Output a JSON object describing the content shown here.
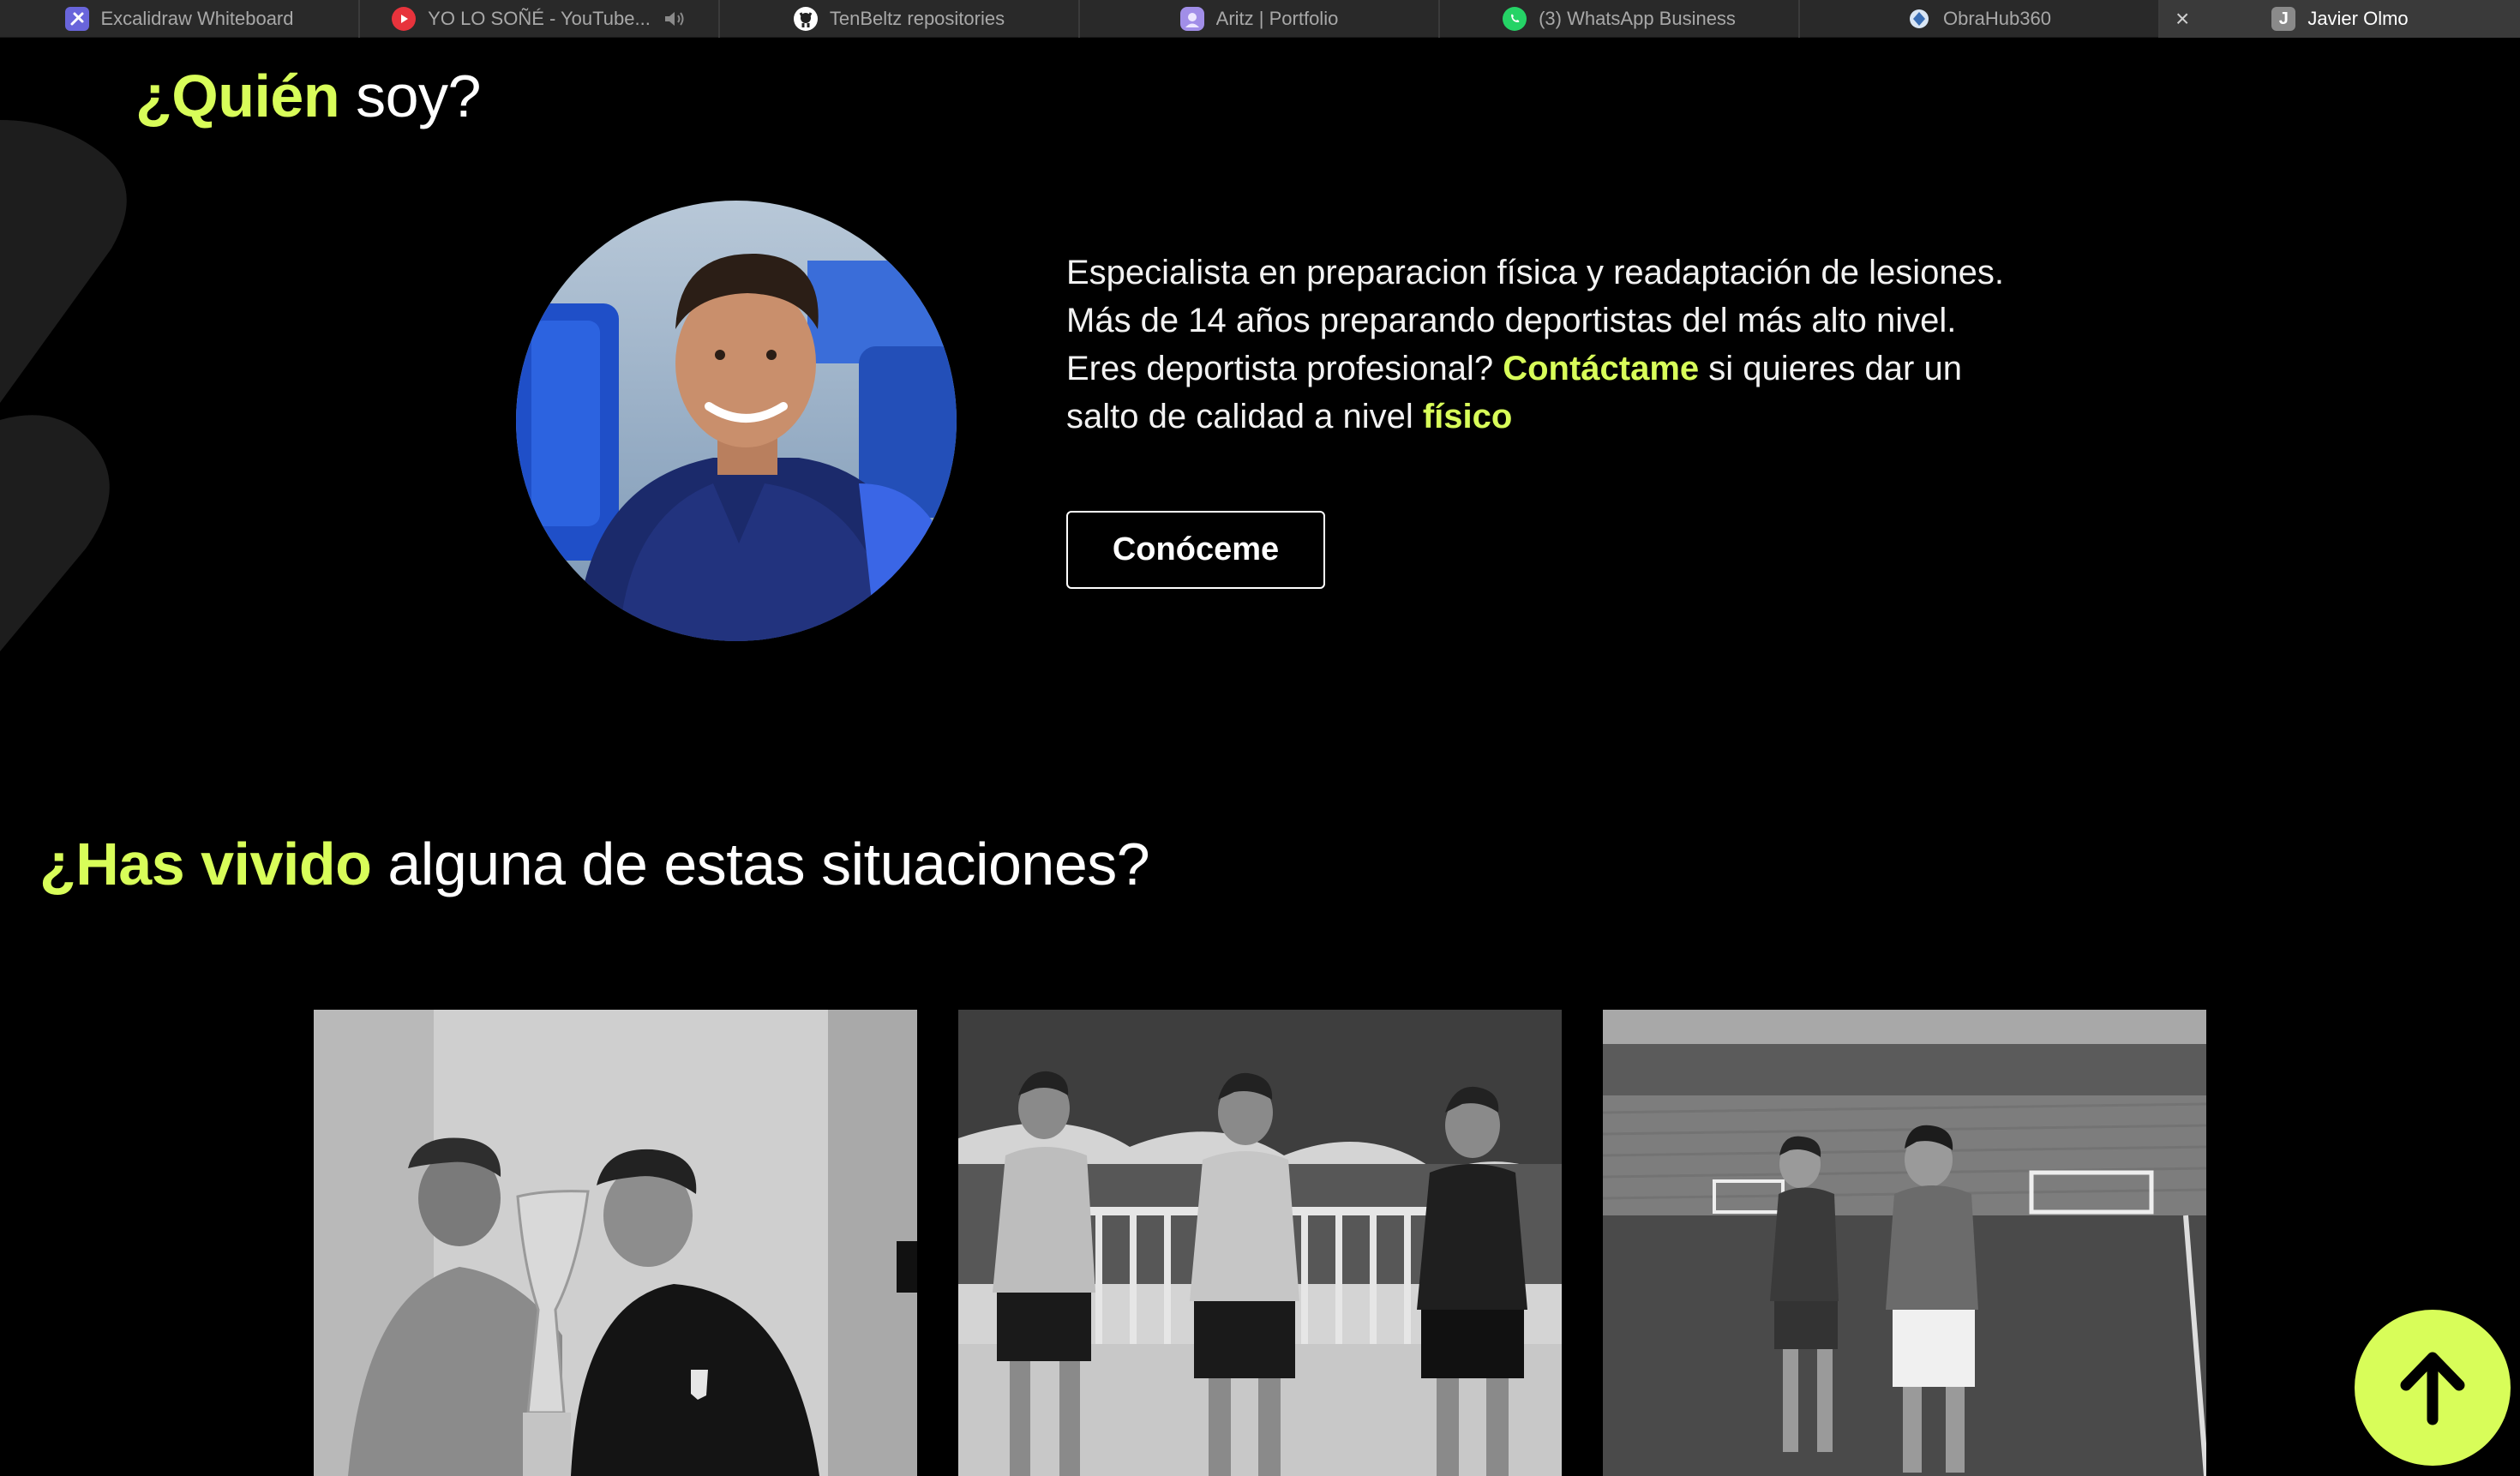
{
  "browser": {
    "tabs": [
      {
        "title": "Excalidraw Whiteboard",
        "icon": "excalidraw-icon",
        "active": false
      },
      {
        "title": "YO LO SOÑÉ - YouTube...",
        "icon": "youtube-icon",
        "active": false,
        "audio": true
      },
      {
        "title": "TenBeltz repositories",
        "icon": "github-icon",
        "active": false
      },
      {
        "title": "Aritz | Portfolio",
        "icon": "portfolio-icon",
        "active": false
      },
      {
        "title": "(3) WhatsApp Business",
        "icon": "whatsapp-icon",
        "active": false
      },
      {
        "title": "ObraHub360",
        "icon": "obrahub-icon",
        "active": false
      },
      {
        "title": "Javier Olmo",
        "icon": "letter-avatar-icon",
        "icon_letter": "J",
        "active": true
      }
    ]
  },
  "about": {
    "title_highlight": "¿Quién",
    "title_rest": "soy?",
    "line1": "Especialista en preparacion física y readaptación de lesiones.",
    "line2": "Más de 14 años preparando deportistas del más alto nivel.",
    "line3_before": "Eres deportista profesional? ",
    "line3_link": "Contáctame",
    "line3_after": " si quieres dar un salto de calidad a nivel ",
    "line3_end": "físico",
    "button_label": "Conóceme"
  },
  "situations": {
    "title_highlight": "¿Has vivido",
    "title_rest": "alguna de estas situaciones?",
    "photos": [
      {
        "name": "trophy-photo"
      },
      {
        "name": "training-run-photo"
      },
      {
        "name": "stadium-run-photo"
      }
    ]
  },
  "scroll_top": {
    "icon": "arrow-up-icon"
  },
  "colors": {
    "accent": "#d8fd59",
    "background": "#000000",
    "tabbar": "#292929"
  }
}
